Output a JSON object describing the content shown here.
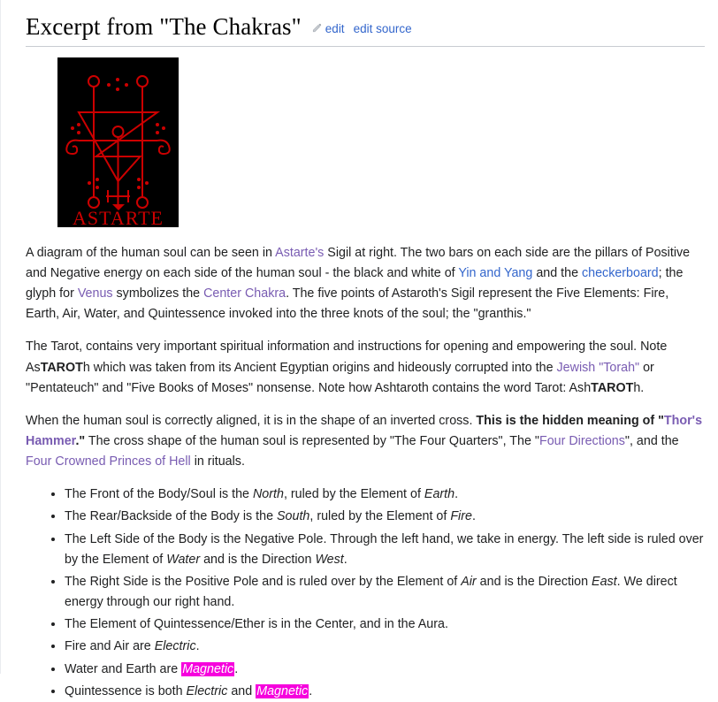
{
  "page": {
    "title": "Excerpt from \"The Chakras\"",
    "edit_label": "edit",
    "edit_source_label": "edit source",
    "pencil_icon": "pencil-icon",
    "link_color": "#3366cc",
    "visited_link_color": "#795cb2",
    "highlight_color": "#f601dd",
    "text_color": "#202122"
  },
  "figure": {
    "caption_text": "ASTARTE",
    "background_color": "#000000",
    "sigil_color": "#cc0000",
    "alt": "Sigil of Astarte"
  },
  "paragraphs": {
    "p1": {
      "s1": "A diagram of the human soul can be seen in ",
      "link_astartes": "Astarte's",
      "s2": " Sigil at right. The two bars on each side are the pillars of Positive and Negative energy on each side of the human soul - the black and white of ",
      "link_yin_yang": "Yin and Yang",
      "s3": " and the ",
      "link_checkerboard": "checkerboard",
      "s4": "; the glyph for ",
      "link_venus": "Venus",
      "s5": " symbolizes the ",
      "link_center_chakra": "Center Chakra",
      "s6": ". The five points of Astaroth's Sigil represent the Five Elements: Fire, Earth, Air, Water, and Quintessence invoked into the three knots of the soul; the \"granthis.\""
    },
    "p2": {
      "s1": "The Tarot, contains very important spiritual information and instructions for opening and empowering the soul. Note As",
      "bold_tarot_1": "TAROT",
      "s2": "h which was taken from its Ancient Egyptian origins and hideously corrupted into the ",
      "link_jewish_torah": "Jewish \"Torah\"",
      "s3": " or \"Pentateuch\" and \"Five Books of Moses\" nonsense. Note how Ashtaroth contains the word Tarot: Ash",
      "bold_tarot_2": "TAROT",
      "s4": "h."
    },
    "p3": {
      "s1": "When the human soul is correctly aligned, it is in the shape of an inverted cross. ",
      "bold_hidden_meaning": "This is the hidden meaning of \"",
      "bold_link_thors_hammer": "Thor's Hammer",
      "bold_close": ".\"",
      "s2": " The cross shape of the human soul is represented by \"The Four Quarters\", The \"",
      "link_four_directions": "Four Directions",
      "s3": "\", and the ",
      "link_four_crowned": "Four Crowned Princes of Hell",
      "s4": " in rituals."
    }
  },
  "bullets": [
    {
      "parts": [
        {
          "t": "The Front of the Body/Soul is the ",
          "style": "normal"
        },
        {
          "t": "North",
          "style": "italic"
        },
        {
          "t": ", ruled by the Element of ",
          "style": "normal"
        },
        {
          "t": "Earth",
          "style": "italic"
        },
        {
          "t": ".",
          "style": "normal"
        }
      ]
    },
    {
      "parts": [
        {
          "t": "The Rear/Backside of the Body is the ",
          "style": "normal"
        },
        {
          "t": "South",
          "style": "italic"
        },
        {
          "t": ", ruled by the Element of ",
          "style": "normal"
        },
        {
          "t": "Fire",
          "style": "italic"
        },
        {
          "t": ".",
          "style": "normal"
        }
      ]
    },
    {
      "parts": [
        {
          "t": "The Left Side of the Body is the Negative Pole. Through the left hand, we take in energy. The left side is ruled over by the Element of ",
          "style": "normal"
        },
        {
          "t": "Water",
          "style": "italic"
        },
        {
          "t": " and is the Direction ",
          "style": "normal"
        },
        {
          "t": "West",
          "style": "italic"
        },
        {
          "t": ".",
          "style": "normal"
        }
      ]
    },
    {
      "parts": [
        {
          "t": "The Right Side is the Positive Pole and is ruled over by the Element of ",
          "style": "normal"
        },
        {
          "t": "Air",
          "style": "italic"
        },
        {
          "t": " and is the Direction ",
          "style": "normal"
        },
        {
          "t": "East",
          "style": "italic"
        },
        {
          "t": ". We direct energy through our right hand.",
          "style": "normal"
        }
      ]
    },
    {
      "parts": [
        {
          "t": "The Element of Quintessence/Ether is in the Center, and in the Aura.",
          "style": "normal"
        }
      ]
    },
    {
      "parts": [
        {
          "t": "Fire and Air are ",
          "style": "normal"
        },
        {
          "t": "Electric",
          "style": "italic"
        },
        {
          "t": ".",
          "style": "normal"
        }
      ]
    },
    {
      "parts": [
        {
          "t": "Water and Earth are ",
          "style": "normal"
        },
        {
          "t": "Magnetic",
          "style": "highlight"
        },
        {
          "t": ".",
          "style": "normal"
        }
      ]
    },
    {
      "parts": [
        {
          "t": "Quintessence is both ",
          "style": "normal"
        },
        {
          "t": "Electric",
          "style": "italic"
        },
        {
          "t": " and ",
          "style": "normal"
        },
        {
          "t": "Magnetic",
          "style": "highlight"
        },
        {
          "t": ".",
          "style": "normal"
        }
      ]
    }
  ]
}
